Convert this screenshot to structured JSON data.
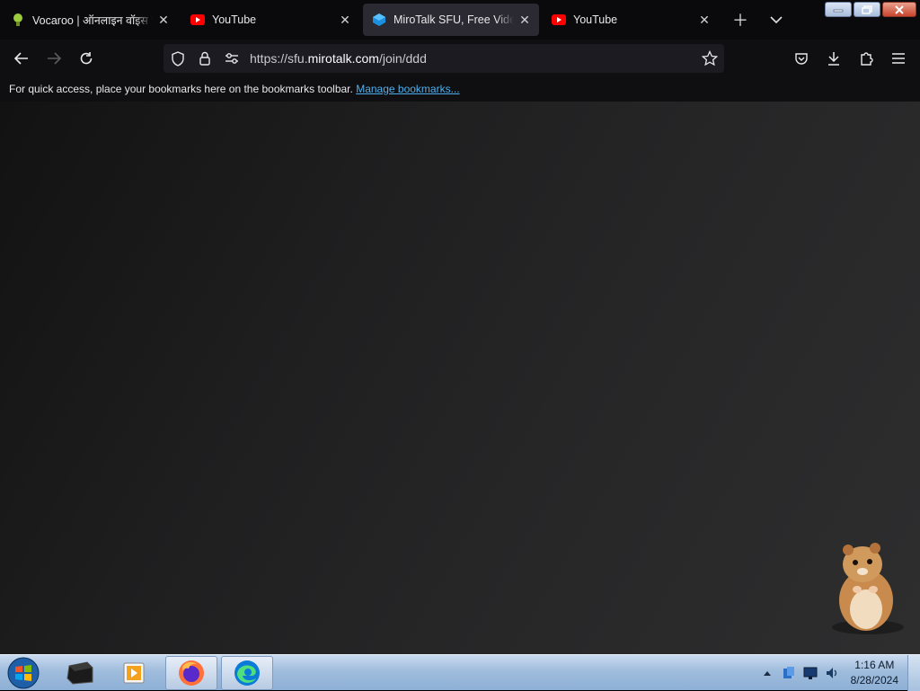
{
  "tabs": [
    {
      "title": "Vocaroo | ऑनलाइन वॉइस रि",
      "favicon": "vocaroo-icon",
      "active": false
    },
    {
      "title": "YouTube",
      "favicon": "youtube-icon",
      "active": false
    },
    {
      "title": "MiroTalk SFU, Free Video C",
      "favicon": "mirotalk-icon",
      "active": true
    },
    {
      "title": "YouTube",
      "favicon": "youtube-icon",
      "active": false
    }
  ],
  "url": {
    "prefix": "https://sfu.",
    "host": "mirotalk.com",
    "path": "/join/ddd"
  },
  "bookmarks": {
    "message": "For quick access, place your bookmarks here on the bookmarks toolbar.",
    "link": "Manage bookmarks..."
  },
  "clock": {
    "time": "1:16 AM",
    "date": "8/28/2024"
  },
  "colors": {
    "accent_link": "#4fb0ee",
    "youtube_red": "#ff0000",
    "active_tab": "#2b2a33"
  }
}
